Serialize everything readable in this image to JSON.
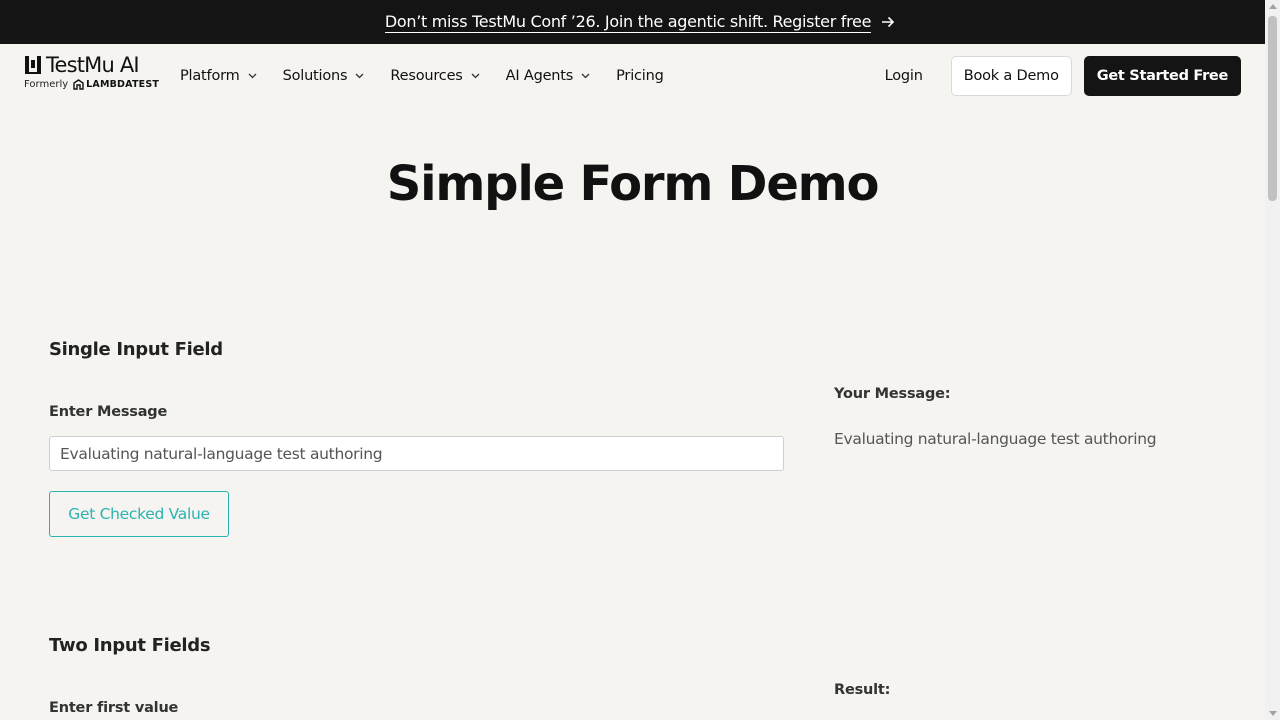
{
  "banner": {
    "text": "Don’t miss TestMu Conf ’26. Join the agentic shift. Register free"
  },
  "logo": {
    "name": "TestMu AI",
    "formerly": "Formerly",
    "former_brand": "LAMBDATEST"
  },
  "nav": {
    "items": [
      {
        "label": "Platform",
        "has_dropdown": true
      },
      {
        "label": "Solutions",
        "has_dropdown": true
      },
      {
        "label": "Resources",
        "has_dropdown": true
      },
      {
        "label": "AI Agents",
        "has_dropdown": true
      },
      {
        "label": "Pricing",
        "has_dropdown": false
      }
    ],
    "login": "Login",
    "book_demo": "Book a Demo",
    "get_started": "Get Started Free"
  },
  "page": {
    "title": "Simple Form Demo"
  },
  "single_input": {
    "section_title": "Single Input Field",
    "label": "Enter Message",
    "value": "Evaluating natural-language test authoring",
    "button": "Get Checked Value",
    "result_label": "Your Message:",
    "result_value": "Evaluating natural-language test authoring"
  },
  "two_inputs": {
    "section_title": "Two Input Fields",
    "first_label": "Enter first value",
    "result_label": "Result:"
  },
  "colors": {
    "accent": "#2bb3b0",
    "dark": "#141414",
    "background": "#f5f4f1"
  }
}
